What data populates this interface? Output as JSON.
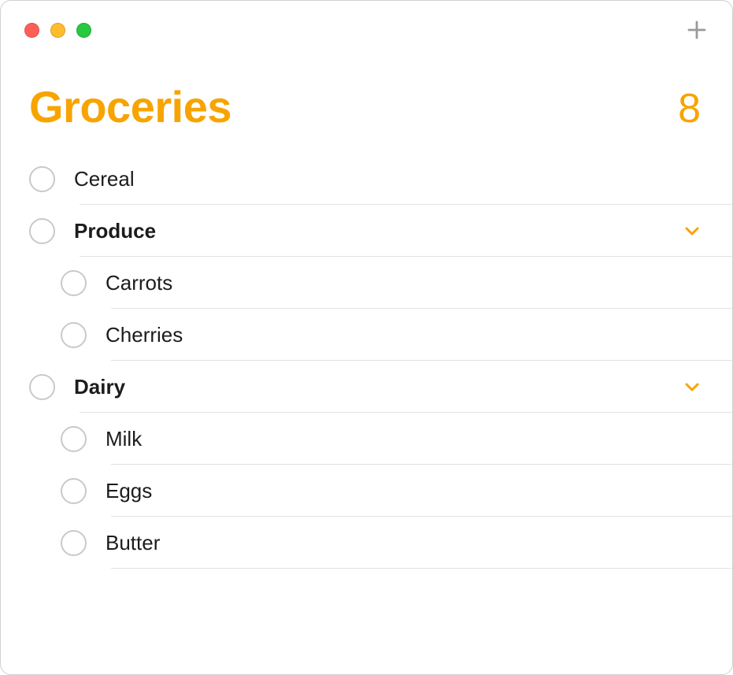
{
  "accent_color": "#f7a400",
  "header": {
    "title": "Groceries",
    "count": "8"
  },
  "items": {
    "cereal": {
      "label": "Cereal"
    },
    "produce": {
      "label": "Produce"
    },
    "carrots": {
      "label": "Carrots"
    },
    "cherries": {
      "label": "Cherries"
    },
    "dairy": {
      "label": "Dairy"
    },
    "milk": {
      "label": "Milk"
    },
    "eggs": {
      "label": "Eggs"
    },
    "butter": {
      "label": "Butter"
    }
  }
}
